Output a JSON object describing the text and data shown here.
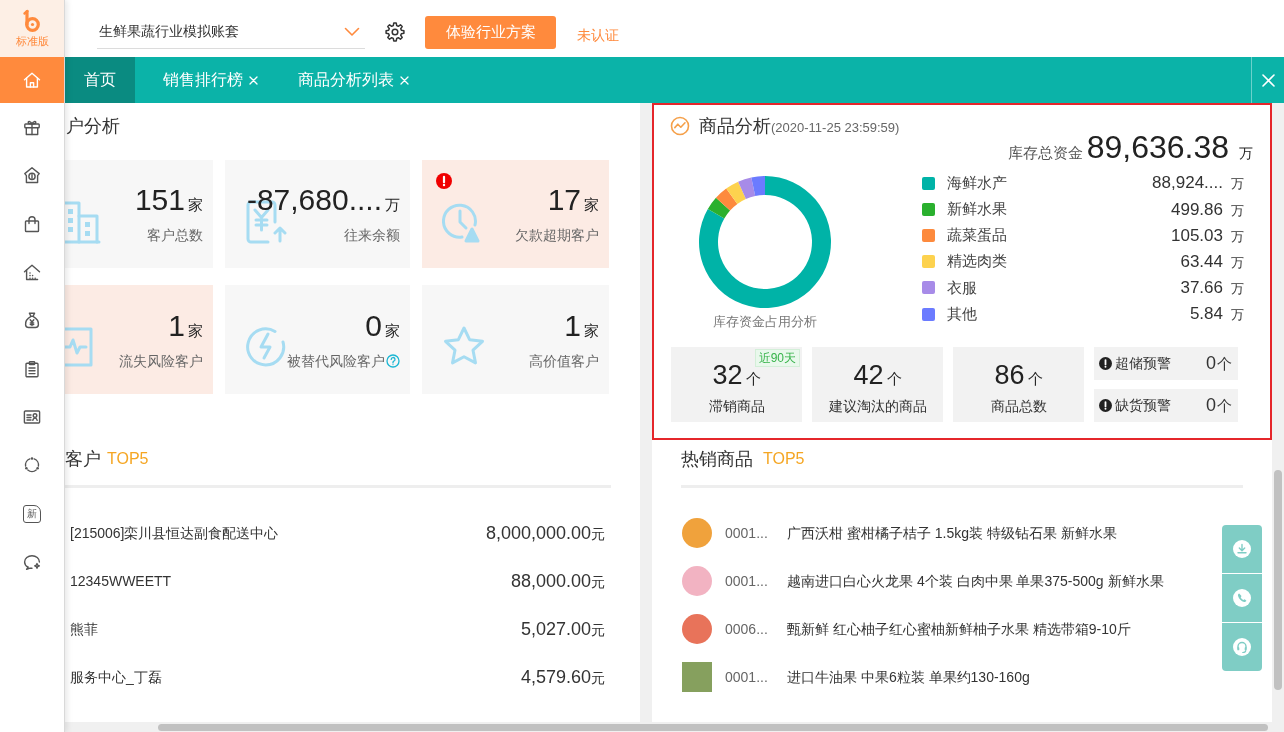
{
  "sidebar": {
    "edition": "标准版",
    "items": [
      {
        "selected": true
      },
      {
        "selected": false
      },
      {
        "selected": false
      },
      {
        "selected": false
      },
      {
        "selected": false
      },
      {
        "selected": false
      },
      {
        "selected": false
      },
      {
        "selected": false
      },
      {
        "selected": false
      },
      {
        "selected": false,
        "text": "新"
      },
      {
        "selected": false
      }
    ]
  },
  "top_bar": {
    "account_select": {
      "value": "生鲜果蔬行业模拟账套"
    },
    "action_button": "体验行业方案",
    "certification_status": "未认证"
  },
  "tabs": [
    {
      "label": "首页",
      "selected": true,
      "closable": false
    },
    {
      "label": "销售排行榜",
      "selected": false,
      "closable": true
    },
    {
      "label": "商品分析列表",
      "selected": false,
      "closable": true
    }
  ],
  "customer_analysis": {
    "title": "户分析",
    "cards": [
      {
        "value": "151",
        "unit": "家",
        "label": "客户总数",
        "alert": false,
        "flagged": false,
        "help": false
      },
      {
        "value": "-87,680....",
        "unit": "万",
        "label": "往来余额",
        "alert": false,
        "flagged": false,
        "help": false
      },
      {
        "value": "17",
        "unit": "家",
        "label": "欠款超期客户",
        "alert": true,
        "flagged": true,
        "help": false
      },
      {
        "value": "1",
        "unit": "家",
        "label": "流失风险客户",
        "alert": true,
        "flagged": false,
        "help": false
      },
      {
        "value": "0",
        "unit": "家",
        "label": "被替代风险客户",
        "alert": false,
        "flagged": false,
        "help": true
      },
      {
        "value": "1",
        "unit": "家",
        "label": "高价值客户",
        "alert": false,
        "flagged": false,
        "help": false
      }
    ]
  },
  "top_customers": {
    "title": "客户",
    "rank": "TOP5",
    "rows": [
      {
        "name": "[215006]栾川县恒达副食配送中心",
        "amount": "8,000,000.00",
        "unit": "元"
      },
      {
        "name": "12345WWEETT",
        "amount": "88,000.00",
        "unit": "元"
      },
      {
        "name": "熊菲",
        "amount": "5,027.00",
        "unit": "元"
      },
      {
        "name": "服务中心_丁磊",
        "amount": "4,579.60",
        "unit": "元"
      }
    ]
  },
  "product_analysis": {
    "title": "商品分析",
    "timestamp": "(2020-11-25 23:59:59)",
    "total_label": "库存总资金",
    "total_value": "89,636.38",
    "total_unit": "万",
    "chart_title": "库存资金占用分析",
    "legend": [
      {
        "label": "海鲜水产",
        "color": "#00b3a7",
        "amount": "88,924....",
        "unit": "万"
      },
      {
        "label": "新鲜水果",
        "color": "#2ab02e",
        "amount": "499.86",
        "unit": "万"
      },
      {
        "label": "蔬菜蛋品",
        "color": "#fd8a3d",
        "amount": "105.03",
        "unit": "万"
      },
      {
        "label": "精选肉类",
        "color": "#fdd24e",
        "amount": "63.44",
        "unit": "万"
      },
      {
        "label": "衣服",
        "color": "#a78be8",
        "amount": "37.66",
        "unit": "万"
      },
      {
        "label": "其他",
        "color": "#6b7bff",
        "amount": "5.84",
        "unit": "万"
      }
    ],
    "stat_cards": [
      {
        "value": "32",
        "unit": "个",
        "label": "滞销商品",
        "tag": "近90天"
      },
      {
        "value": "42",
        "unit": "个",
        "label": "建议淘汰的商品"
      },
      {
        "value": "86",
        "unit": "个",
        "label": "商品总数"
      }
    ],
    "warnings": [
      {
        "label": "超储预警",
        "value": "0",
        "unit": "个"
      },
      {
        "label": "缺货预警",
        "value": "0",
        "unit": "个"
      }
    ]
  },
  "hot_products": {
    "title": "热销商品",
    "rank": "TOP5",
    "rows": [
      {
        "code": "0001...",
        "name": "广西沃柑 蜜柑橘子桔子 1.5kg装 特级钻石果 新鲜水果"
      },
      {
        "code": "0001...",
        "name": "越南进口白心火龙果 4个装 白肉中果 单果375-500g 新鲜水果"
      },
      {
        "code": "0006...",
        "name": "甄新鲜 红心柚子红心蜜柚新鲜柚子水果 精选带箱9-10斤"
      },
      {
        "code": "0001...",
        "name": "进口牛油果 中果6粒装 单果约130-160g"
      }
    ]
  }
}
